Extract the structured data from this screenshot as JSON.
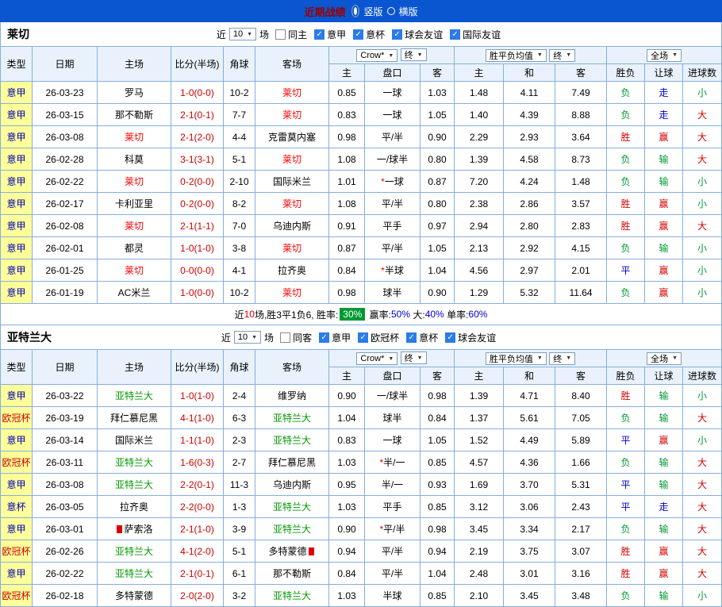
{
  "title_bar": {
    "title": "近期战绩",
    "vertical": "竖版",
    "horizontal": "横版"
  },
  "columns": {
    "type": "类型",
    "date": "日期",
    "home": "主场",
    "score": "比分(半场)",
    "corner": "角球",
    "away": "客场",
    "h": "主",
    "hcp": "盘口",
    "a": "客",
    "eh": "主",
    "ed": "和",
    "ea": "客",
    "wdl": "胜负",
    "handicap_res": "让球",
    "ou": "进球数"
  },
  "selects": {
    "book": "Crow*",
    "final1": "终",
    "avg": "胜平负均值",
    "final2": "终",
    "scope": "全场"
  },
  "filters_common": {
    "near": "近",
    "count": "10",
    "games": "场"
  },
  "sections": [
    {
      "team": "莱切",
      "focal_color": "#ff0000",
      "checkboxes": [
        {
          "label": "同主",
          "checked": false
        },
        {
          "label": "意甲",
          "checked": true
        },
        {
          "label": "意杯",
          "checked": true
        },
        {
          "label": "球会友谊",
          "checked": true
        },
        {
          "label": "国际友谊",
          "checked": true
        }
      ],
      "rows": [
        {
          "lg": "意甲",
          "lgc": "b",
          "d": "26-03-23",
          "h": "罗马",
          "s": "1-0(0-0)",
          "cn": "10-2",
          "a": "莱切",
          "af": true,
          "o1": "0.85",
          "hp": "一球",
          "o2": "1.03",
          "e1": "1.48",
          "e2": "4.11",
          "e3": "7.49",
          "r1": "负",
          "c1": "g",
          "r2": "走",
          "c2": "b",
          "r3": "小",
          "c3": "g"
        },
        {
          "lg": "意甲",
          "lgc": "b",
          "d": "26-03-15",
          "h": "那不勒斯",
          "s": "2-1(0-1)",
          "cn": "7-7",
          "a": "莱切",
          "af": true,
          "o1": "0.83",
          "hp": "一球",
          "o2": "1.05",
          "e1": "1.40",
          "e2": "4.39",
          "e3": "8.88",
          "r1": "负",
          "c1": "g",
          "r2": "走",
          "c2": "b",
          "r3": "大",
          "c3": "r"
        },
        {
          "lg": "意甲",
          "lgc": "b",
          "d": "26-03-08",
          "h": "莱切",
          "hf": true,
          "s": "2-1(2-0)",
          "cn": "4-4",
          "a": "克雷莫内塞",
          "o1": "0.98",
          "hp": "平/半",
          "o2": "0.90",
          "e1": "2.29",
          "e2": "2.93",
          "e3": "3.64",
          "r1": "胜",
          "c1": "r",
          "r2": "赢",
          "c2": "r",
          "r3": "大",
          "c3": "r"
        },
        {
          "lg": "意甲",
          "lgc": "b",
          "d": "26-02-28",
          "h": "科莫",
          "s": "3-1(3-1)",
          "cn": "5-1",
          "a": "莱切",
          "af": true,
          "o1": "1.08",
          "hp": "一/球半",
          "o2": "0.80",
          "e1": "1.39",
          "e2": "4.58",
          "e3": "8.73",
          "r1": "负",
          "c1": "g",
          "r2": "输",
          "c2": "g",
          "r3": "大",
          "c3": "r"
        },
        {
          "lg": "意甲",
          "lgc": "b",
          "d": "26-02-22",
          "h": "莱切",
          "hf": true,
          "s": "0-2(0-0)",
          "cn": "2-10",
          "a": "国际米兰",
          "o1": "1.01",
          "st": true,
          "hp": "一球",
          "o2": "0.87",
          "e1": "7.20",
          "e2": "4.24",
          "e3": "1.48",
          "r1": "负",
          "c1": "g",
          "r2": "输",
          "c2": "g",
          "r3": "小",
          "c3": "g"
        },
        {
          "lg": "意甲",
          "lgc": "b",
          "d": "26-02-17",
          "h": "卡利亚里",
          "s": "0-2(0-0)",
          "cn": "8-2",
          "a": "莱切",
          "af": true,
          "o1": "1.08",
          "hp": "平/半",
          "o2": "0.80",
          "e1": "2.38",
          "e2": "2.86",
          "e3": "3.57",
          "r1": "胜",
          "c1": "r",
          "r2": "赢",
          "c2": "r",
          "r3": "小",
          "c3": "g"
        },
        {
          "lg": "意甲",
          "lgc": "b",
          "d": "26-02-08",
          "h": "莱切",
          "hf": true,
          "s": "2-1(1-1)",
          "cn": "7-0",
          "a": "乌迪内斯",
          "o1": "0.91",
          "hp": "平手",
          "o2": "0.97",
          "e1": "2.94",
          "e2": "2.80",
          "e3": "2.83",
          "r1": "胜",
          "c1": "r",
          "r2": "赢",
          "c2": "r",
          "r3": "大",
          "c3": "r"
        },
        {
          "lg": "意甲",
          "lgc": "b",
          "d": "26-02-01",
          "h": "都灵",
          "s": "1-0(1-0)",
          "cn": "3-8",
          "a": "莱切",
          "af": true,
          "o1": "0.87",
          "hp": "平/半",
          "o2": "1.05",
          "e1": "2.13",
          "e2": "2.92",
          "e3": "4.15",
          "r1": "负",
          "c1": "g",
          "r2": "输",
          "c2": "g",
          "r3": "小",
          "c3": "g"
        },
        {
          "lg": "意甲",
          "lgc": "b",
          "d": "26-01-25",
          "h": "莱切",
          "hf": true,
          "s": "0-0(0-0)",
          "cn": "4-1",
          "a": "拉齐奥",
          "o1": "0.84",
          "st": true,
          "hp": "半球",
          "o2": "1.04",
          "e1": "4.56",
          "e2": "2.97",
          "e3": "2.01",
          "r1": "平",
          "c1": "b",
          "r2": "赢",
          "c2": "r",
          "r3": "小",
          "c3": "g"
        },
        {
          "lg": "意甲",
          "lgc": "b",
          "d": "26-01-19",
          "h": "AC米兰",
          "s": "1-0(0-0)",
          "cn": "10-2",
          "a": "莱切",
          "af": true,
          "o1": "0.98",
          "hp": "球半",
          "o2": "0.90",
          "e1": "1.29",
          "e2": "5.32",
          "e3": "11.64",
          "r1": "负",
          "c1": "g",
          "r2": "赢",
          "c2": "r",
          "r3": "小",
          "c3": "g"
        }
      ],
      "summary": {
        "parts": [
          {
            "t": "近",
            "c": "k"
          },
          {
            "t": "10",
            "c": "r"
          },
          {
            "t": "场,胜3平1负6, 胜率:",
            "c": "k"
          },
          {
            "t": "30%",
            "c": "box"
          },
          {
            "t": " 赢率:",
            "c": "k"
          },
          {
            "t": "50%",
            "c": "b"
          },
          {
            "t": " 大:",
            "c": "k"
          },
          {
            "t": "40%",
            "c": "b"
          },
          {
            "t": " 单率:",
            "c": "k"
          },
          {
            "t": "60%",
            "c": "b"
          }
        ]
      }
    },
    {
      "team": "亚特兰大",
      "focal_color": "#009900",
      "checkboxes": [
        {
          "label": "同客",
          "checked": false
        },
        {
          "label": "意甲",
          "checked": true
        },
        {
          "label": "欧冠杯",
          "checked": true
        },
        {
          "label": "意杯",
          "checked": true
        },
        {
          "label": "球会友谊",
          "checked": true
        }
      ],
      "rows": [
        {
          "lg": "意甲",
          "lgc": "b",
          "d": "26-03-22",
          "h": "亚特兰大",
          "hf": true,
          "s": "1-0(1-0)",
          "cn": "2-4",
          "a": "维罗纳",
          "o1": "0.90",
          "hp": "一/球半",
          "o2": "0.98",
          "e1": "1.39",
          "e2": "4.71",
          "e3": "8.40",
          "r1": "胜",
          "c1": "r",
          "r2": "输",
          "c2": "g",
          "r3": "小",
          "c3": "g"
        },
        {
          "lg": "欧冠杯",
          "lgc": "r",
          "d": "26-03-19",
          "h": "拜仁慕尼黑",
          "s": "4-1(1-0)",
          "cn": "6-3",
          "a": "亚特兰大",
          "af": true,
          "o1": "1.04",
          "hp": "球半",
          "o2": "0.84",
          "e1": "1.37",
          "e2": "5.61",
          "e3": "7.05",
          "r1": "负",
          "c1": "g",
          "r2": "输",
          "c2": "g",
          "r3": "大",
          "c3": "r"
        },
        {
          "lg": "意甲",
          "lgc": "b",
          "d": "26-03-14",
          "h": "国际米兰",
          "s": "1-1(1-0)",
          "cn": "2-3",
          "a": "亚特兰大",
          "af": true,
          "o1": "0.83",
          "hp": "一球",
          "o2": "1.05",
          "e1": "1.52",
          "e2": "4.49",
          "e3": "5.89",
          "r1": "平",
          "c1": "b",
          "r2": "赢",
          "c2": "r",
          "r3": "小",
          "c3": "g"
        },
        {
          "lg": "欧冠杯",
          "lgc": "r",
          "d": "26-03-11",
          "h": "亚特兰大",
          "hf": true,
          "s": "1-6(0-3)",
          "cn": "2-7",
          "a": "拜仁慕尼黑",
          "o1": "1.03",
          "st": true,
          "hp": "半/一",
          "o2": "0.85",
          "e1": "4.57",
          "e2": "4.36",
          "e3": "1.66",
          "r1": "负",
          "c1": "g",
          "r2": "输",
          "c2": "g",
          "r3": "大",
          "c3": "r"
        },
        {
          "lg": "意甲",
          "lgc": "b",
          "d": "26-03-08",
          "h": "亚特兰大",
          "hf": true,
          "s": "2-2(0-1)",
          "cn": "11-3",
          "a": "乌迪内斯",
          "o1": "0.95",
          "hp": "半/一",
          "o2": "0.93",
          "e1": "1.69",
          "e2": "3.70",
          "e3": "5.31",
          "r1": "平",
          "c1": "b",
          "r2": "输",
          "c2": "g",
          "r3": "大",
          "c3": "r"
        },
        {
          "lg": "意杯",
          "lgc": "b",
          "d": "26-03-05",
          "h": "拉齐奥",
          "s": "2-2(0-0)",
          "cn": "1-3",
          "a": "亚特兰大",
          "af": true,
          "o1": "1.03",
          "hp": "平手",
          "o2": "0.85",
          "e1": "3.12",
          "e2": "3.06",
          "e3": "2.43",
          "r1": "平",
          "c1": "b",
          "r2": "走",
          "c2": "b",
          "r3": "大",
          "c3": "r"
        },
        {
          "lg": "意甲",
          "lgc": "b",
          "d": "26-03-01",
          "h": "萨索洛",
          "hc": true,
          "s": "2-1(1-0)",
          "cn": "3-9",
          "a": "亚特兰大",
          "af": true,
          "o1": "0.90",
          "st": true,
          "hp": "平/半",
          "o2": "0.98",
          "e1": "3.45",
          "e2": "3.34",
          "e3": "2.17",
          "r1": "负",
          "c1": "g",
          "r2": "输",
          "c2": "g",
          "r3": "大",
          "c3": "r"
        },
        {
          "lg": "欧冠杯",
          "lgc": "r",
          "d": "26-02-26",
          "h": "亚特兰大",
          "hf": true,
          "s": "4-1(2-0)",
          "cn": "5-1",
          "a": "多特蒙德",
          "ac": true,
          "o1": "0.94",
          "hp": "平/半",
          "o2": "0.94",
          "e1": "2.19",
          "e2": "3.75",
          "e3": "3.07",
          "r1": "胜",
          "c1": "r",
          "r2": "赢",
          "c2": "r",
          "r3": "大",
          "c3": "r"
        },
        {
          "lg": "意甲",
          "lgc": "b",
          "d": "26-02-22",
          "h": "亚特兰大",
          "hf": true,
          "s": "2-1(0-1)",
          "cn": "6-1",
          "a": "那不勒斯",
          "o1": "0.84",
          "hp": "平/半",
          "o2": "1.04",
          "e1": "2.48",
          "e2": "3.01",
          "e3": "3.16",
          "r1": "胜",
          "c1": "r",
          "r2": "赢",
          "c2": "r",
          "r3": "大",
          "c3": "r"
        },
        {
          "lg": "欧冠杯",
          "lgc": "r",
          "d": "26-02-18",
          "h": "多特蒙德",
          "s": "2-0(2-0)",
          "cn": "3-2",
          "a": "亚特兰大",
          "af": true,
          "o1": "1.03",
          "hp": "半球",
          "o2": "0.85",
          "e1": "2.10",
          "e2": "3.45",
          "e3": "3.48",
          "r1": "负",
          "c1": "g",
          "r2": "输",
          "c2": "g",
          "r3": "小",
          "c3": "g"
        }
      ]
    }
  ]
}
